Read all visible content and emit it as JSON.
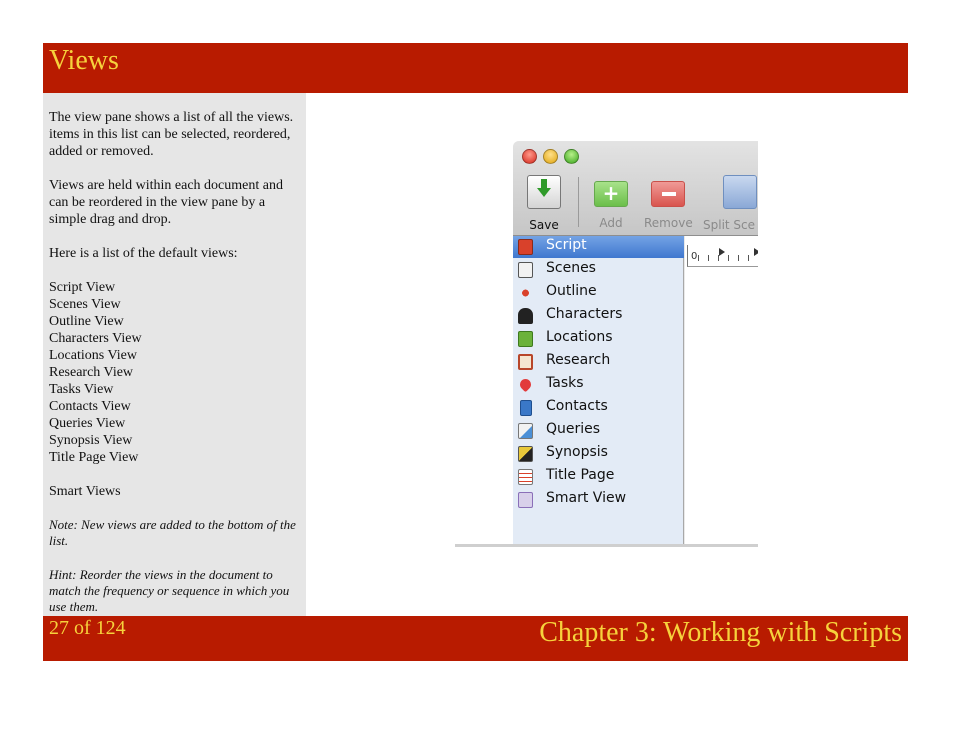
{
  "header": {
    "title": "Views"
  },
  "body": {
    "paragraphs": [
      "The view pane shows a list of all the views. items in this list can be selected, reordered, added or removed.",
      "Views are held within each document and can be reordered in the view pane by a simple drag and drop.",
      "Here is a list of the default views:"
    ],
    "default_views": [
      "Script View",
      "Scenes View",
      "Outline View",
      "Characters View",
      "Locations View",
      "Research View",
      "Tasks View",
      "Contacts View",
      "Queries View",
      "Synopsis View",
      "Title Page View"
    ],
    "smart_views": "Smart Views",
    "note": "Note: New views are added to the bottom of the list.",
    "hint": "Hint: Reorder the views in the document to match the frequency or sequence in which you use them."
  },
  "footer": {
    "page": "27 of 124",
    "chapter": "Chapter 3: Working with Scripts"
  },
  "app": {
    "toolbar": {
      "save_label": "Save",
      "add_label": "Add",
      "remove_label": "Remove",
      "split_label": "Split Sce"
    },
    "sidebar": {
      "items": [
        {
          "label": "Script",
          "icon": "script-icon",
          "color": "#d9412b",
          "selected": true
        },
        {
          "label": "Scenes",
          "icon": "scenes-icon",
          "color": "#f2f2f2"
        },
        {
          "label": "Outline",
          "icon": "outline-icon",
          "color": "#d9412b"
        },
        {
          "label": "Characters",
          "icon": "characters-icon",
          "color": "#222222"
        },
        {
          "label": "Locations",
          "icon": "locations-icon",
          "color": "#6bb23a"
        },
        {
          "label": "Research",
          "icon": "research-icon",
          "color": "#b8462a"
        },
        {
          "label": "Tasks",
          "icon": "tasks-icon",
          "color": "#e23b3b"
        },
        {
          "label": "Contacts",
          "icon": "contacts-icon",
          "color": "#3a78c8"
        },
        {
          "label": "Queries",
          "icon": "queries-icon",
          "color": "#4a8fd6"
        },
        {
          "label": "Synopsis",
          "icon": "synopsis-icon",
          "color": "#e8c83a"
        },
        {
          "label": "Title Page",
          "icon": "title-page-icon",
          "color": "#d9412b"
        },
        {
          "label": "Smart View",
          "icon": "smart-view-icon",
          "color": "#8a6fb8"
        }
      ]
    },
    "ruler": {
      "zero_label": "0"
    }
  }
}
